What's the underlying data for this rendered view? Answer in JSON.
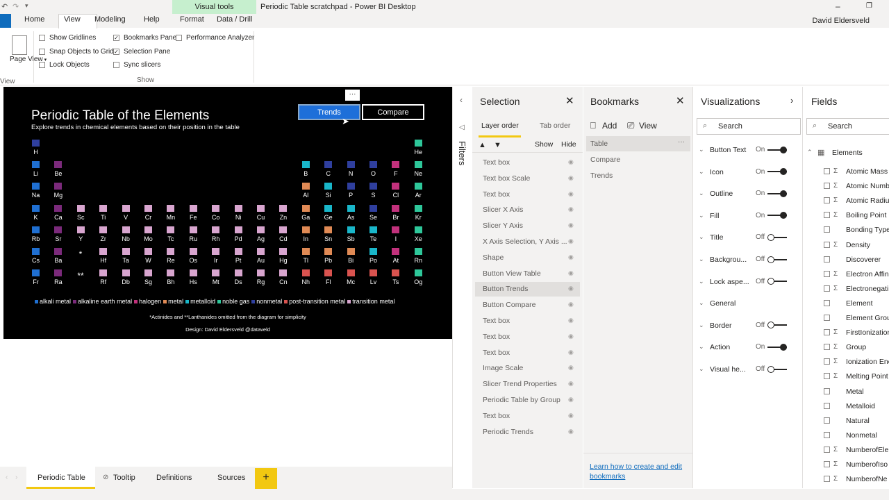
{
  "window": {
    "title": "Periodic Table scratchpad - Power BI Desktop",
    "context_tab": "Visual tools",
    "user": "David Eldersveld"
  },
  "ribbon": {
    "tabs": [
      "Home",
      "View",
      "Modeling",
      "Help",
      "Format",
      "Data / Drill"
    ],
    "page_view": "Page View",
    "checks_col1": [
      {
        "label": "Show Gridlines",
        "checked": false
      },
      {
        "label": "Snap Objects to Grid",
        "checked": false
      },
      {
        "label": "Lock Objects",
        "checked": false
      }
    ],
    "checks_col2": [
      {
        "label": "Bookmarks Pane",
        "checked": true
      },
      {
        "label": "Selection Pane",
        "checked": true
      },
      {
        "label": "Sync slicers",
        "checked": false
      }
    ],
    "checks_col3": [
      {
        "label": "Performance Analyzer",
        "checked": false
      }
    ],
    "group_show": "Show",
    "group_view": "View"
  },
  "report": {
    "title": "Periodic Table of the Elements",
    "subtitle": "Explore trends in chemical elements based on their position in the table",
    "btn_trends": "Trends",
    "btn_compare": "Compare",
    "more": "···",
    "star1": "*",
    "star2": "**",
    "footnote": "*Actinides and **Lanthanides omitted from the diagram for simplicity",
    "credit": "Design: David Eldersveld @dataveld",
    "legend": [
      {
        "label": "alkali metal",
        "color": "#1f6fd1"
      },
      {
        "label": "alkaline earth metal",
        "color": "#7b2a7b"
      },
      {
        "label": "halogen",
        "color": "#c2317c"
      },
      {
        "label": "metal",
        "color": "#e08a55"
      },
      {
        "label": "metalloid",
        "color": "#19b6c9"
      },
      {
        "label": "noble gas",
        "color": "#2ec79a"
      },
      {
        "label": "nonmetal",
        "color": "#2f3f9e"
      },
      {
        "label": "post-transition metal",
        "color": "#d9534f"
      },
      {
        "label": "transition metal",
        "color": "#d8a5cf"
      }
    ],
    "elements": [
      [
        "H",
        1,
        1,
        "nonmetal"
      ],
      [
        "He",
        1,
        18,
        "noble"
      ],
      [
        "Li",
        2,
        1,
        "alkali"
      ],
      [
        "Be",
        2,
        2,
        "alkaline"
      ],
      [
        "B",
        2,
        13,
        "metalloid"
      ],
      [
        "C",
        2,
        14,
        "nonmetal"
      ],
      [
        "N",
        2,
        15,
        "nonmetal"
      ],
      [
        "O",
        2,
        16,
        "nonmetal"
      ],
      [
        "F",
        2,
        17,
        "halogen"
      ],
      [
        "Ne",
        2,
        18,
        "noble"
      ],
      [
        "Na",
        3,
        1,
        "alkali"
      ],
      [
        "Mg",
        3,
        2,
        "alkaline"
      ],
      [
        "Al",
        3,
        13,
        "metal"
      ],
      [
        "Si",
        3,
        14,
        "metalloid"
      ],
      [
        "P",
        3,
        15,
        "nonmetal"
      ],
      [
        "S",
        3,
        16,
        "nonmetal"
      ],
      [
        "Cl",
        3,
        17,
        "halogen"
      ],
      [
        "Ar",
        3,
        18,
        "noble"
      ],
      [
        "K",
        4,
        1,
        "alkali"
      ],
      [
        "Ca",
        4,
        2,
        "alkaline"
      ],
      [
        "Sc",
        4,
        3,
        "transition"
      ],
      [
        "Ti",
        4,
        4,
        "transition"
      ],
      [
        "V",
        4,
        5,
        "transition"
      ],
      [
        "Cr",
        4,
        6,
        "transition"
      ],
      [
        "Mn",
        4,
        7,
        "transition"
      ],
      [
        "Fe",
        4,
        8,
        "transition"
      ],
      [
        "Co",
        4,
        9,
        "transition"
      ],
      [
        "Ni",
        4,
        10,
        "transition"
      ],
      [
        "Cu",
        4,
        11,
        "transition"
      ],
      [
        "Zn",
        4,
        12,
        "transition"
      ],
      [
        "Ga",
        4,
        13,
        "metal"
      ],
      [
        "Ge",
        4,
        14,
        "metalloid"
      ],
      [
        "As",
        4,
        15,
        "metalloid"
      ],
      [
        "Se",
        4,
        16,
        "nonmetal"
      ],
      [
        "Br",
        4,
        17,
        "halogen"
      ],
      [
        "Kr",
        4,
        18,
        "noble"
      ],
      [
        "Rb",
        5,
        1,
        "alkali"
      ],
      [
        "Sr",
        5,
        2,
        "alkaline"
      ],
      [
        "Y",
        5,
        3,
        "transition"
      ],
      [
        "Zr",
        5,
        4,
        "transition"
      ],
      [
        "Nb",
        5,
        5,
        "transition"
      ],
      [
        "Mo",
        5,
        6,
        "transition"
      ],
      [
        "Tc",
        5,
        7,
        "transition"
      ],
      [
        "Ru",
        5,
        8,
        "transition"
      ],
      [
        "Rh",
        5,
        9,
        "transition"
      ],
      [
        "Pd",
        5,
        10,
        "transition"
      ],
      [
        "Ag",
        5,
        11,
        "transition"
      ],
      [
        "Cd",
        5,
        12,
        "transition"
      ],
      [
        "In",
        5,
        13,
        "metal"
      ],
      [
        "Sn",
        5,
        14,
        "metal"
      ],
      [
        "Sb",
        5,
        15,
        "metalloid"
      ],
      [
        "Te",
        5,
        16,
        "metalloid"
      ],
      [
        "I",
        5,
        17,
        "halogen"
      ],
      [
        "Xe",
        5,
        18,
        "noble"
      ],
      [
        "Cs",
        6,
        1,
        "alkali"
      ],
      [
        "Ba",
        6,
        2,
        "alkaline"
      ],
      [
        "Hf",
        6,
        4,
        "transition"
      ],
      [
        "Ta",
        6,
        5,
        "transition"
      ],
      [
        "W",
        6,
        6,
        "transition"
      ],
      [
        "Re",
        6,
        7,
        "transition"
      ],
      [
        "Os",
        6,
        8,
        "transition"
      ],
      [
        "Ir",
        6,
        9,
        "transition"
      ],
      [
        "Pt",
        6,
        10,
        "transition"
      ],
      [
        "Au",
        6,
        11,
        "transition"
      ],
      [
        "Hg",
        6,
        12,
        "transition"
      ],
      [
        "Tl",
        6,
        13,
        "metal"
      ],
      [
        "Pb",
        6,
        14,
        "metal"
      ],
      [
        "Bi",
        6,
        15,
        "metal"
      ],
      [
        "Po",
        6,
        16,
        "metalloid"
      ],
      [
        "At",
        6,
        17,
        "halogen"
      ],
      [
        "Rn",
        6,
        18,
        "noble"
      ],
      [
        "Fr",
        7,
        1,
        "alkali"
      ],
      [
        "Ra",
        7,
        2,
        "alkaline"
      ],
      [
        "Rf",
        7,
        4,
        "transition"
      ],
      [
        "Db",
        7,
        5,
        "transition"
      ],
      [
        "Sg",
        7,
        6,
        "transition"
      ],
      [
        "Bh",
        7,
        7,
        "transition"
      ],
      [
        "Hs",
        7,
        8,
        "transition"
      ],
      [
        "Mt",
        7,
        9,
        "transition"
      ],
      [
        "Ds",
        7,
        10,
        "transition"
      ],
      [
        "Rg",
        7,
        11,
        "transition"
      ],
      [
        "Cn",
        7,
        12,
        "transition"
      ],
      [
        "Nh",
        7,
        13,
        "post"
      ],
      [
        "Fl",
        7,
        14,
        "post"
      ],
      [
        "Mc",
        7,
        15,
        "post"
      ],
      [
        "Lv",
        7,
        16,
        "post"
      ],
      [
        "Ts",
        7,
        17,
        "post"
      ],
      [
        "Og",
        7,
        18,
        "noble"
      ]
    ],
    "category_colors": {
      "nonmetal": "#2f3f9e",
      "noble": "#2ec79a",
      "alkali": "#1f6fd1",
      "alkaline": "#7b2a7b",
      "metalloid": "#19b6c9",
      "halogen": "#c2317c",
      "metal": "#e08a55",
      "transition": "#d8a5cf",
      "post": "#d9534f"
    }
  },
  "pages": [
    "Periodic Table",
    "Tooltip",
    "Definitions",
    "Sources"
  ],
  "filters_label": "Filters",
  "selection": {
    "title": "Selection",
    "tab_layer": "Layer order",
    "tab_tab": "Tab order",
    "show": "Show",
    "hide": "Hide",
    "items": [
      "Text box",
      "Text box Scale",
      "Text box",
      "Slicer X Axis",
      "Slicer Y Axis",
      "X Axis Selection, Y Axis ...",
      "Shape",
      "Button View Table",
      "Button Trends",
      "Button Compare",
      "Text box",
      "Text box",
      "Text box",
      "Image Scale",
      "Slicer Trend Properties",
      "Periodic Table by Group",
      "Text box",
      "Periodic Trends"
    ]
  },
  "bookmarks": {
    "title": "Bookmarks",
    "add": "Add",
    "view": "View",
    "items": [
      "Table",
      "Compare",
      "Trends"
    ],
    "learn": "Learn how to create and edit bookmarks"
  },
  "visualizations": {
    "title": "Visualizations",
    "search": "Search",
    "items": [
      {
        "label": "Button Text",
        "state": "On"
      },
      {
        "label": "Icon",
        "state": "On"
      },
      {
        "label": "Outline",
        "state": "On"
      },
      {
        "label": "Fill",
        "state": "On"
      },
      {
        "label": "Title",
        "state": "Off"
      },
      {
        "label": "Backgrou...",
        "state": "Off"
      },
      {
        "label": "Lock aspe...",
        "state": "Off"
      },
      {
        "label": "General",
        "state": ""
      },
      {
        "label": "Border",
        "state": "Off"
      },
      {
        "label": "Action",
        "state": "On"
      },
      {
        "label": "Visual he...",
        "state": "Off"
      }
    ]
  },
  "fields": {
    "title": "Fields",
    "search": "Search",
    "table": "Elements",
    "items": [
      {
        "label": "Atomic Mass",
        "sigma": true
      },
      {
        "label": "Atomic Numb",
        "sigma": true
      },
      {
        "label": "Atomic Radiu",
        "sigma": true
      },
      {
        "label": "Boiling Point",
        "sigma": true
      },
      {
        "label": "Bonding Type",
        "sigma": false
      },
      {
        "label": "Density",
        "sigma": true
      },
      {
        "label": "Discoverer",
        "sigma": false
      },
      {
        "label": "Electron Affin",
        "sigma": true
      },
      {
        "label": "Electronegati",
        "sigma": true
      },
      {
        "label": "Element",
        "sigma": false
      },
      {
        "label": "Element Grou",
        "sigma": false
      },
      {
        "label": "FirstIonization",
        "sigma": true
      },
      {
        "label": "Group",
        "sigma": true
      },
      {
        "label": "Ionization Ene",
        "sigma": true
      },
      {
        "label": "Melting Point",
        "sigma": true
      },
      {
        "label": "Metal",
        "sigma": false
      },
      {
        "label": "Metalloid",
        "sigma": false
      },
      {
        "label": "Natural",
        "sigma": false
      },
      {
        "label": "Nonmetal",
        "sigma": false
      },
      {
        "label": "NumberofEle",
        "sigma": true
      },
      {
        "label": "NumberofIso",
        "sigma": true
      },
      {
        "label": "NumberofNe",
        "sigma": true
      }
    ]
  }
}
